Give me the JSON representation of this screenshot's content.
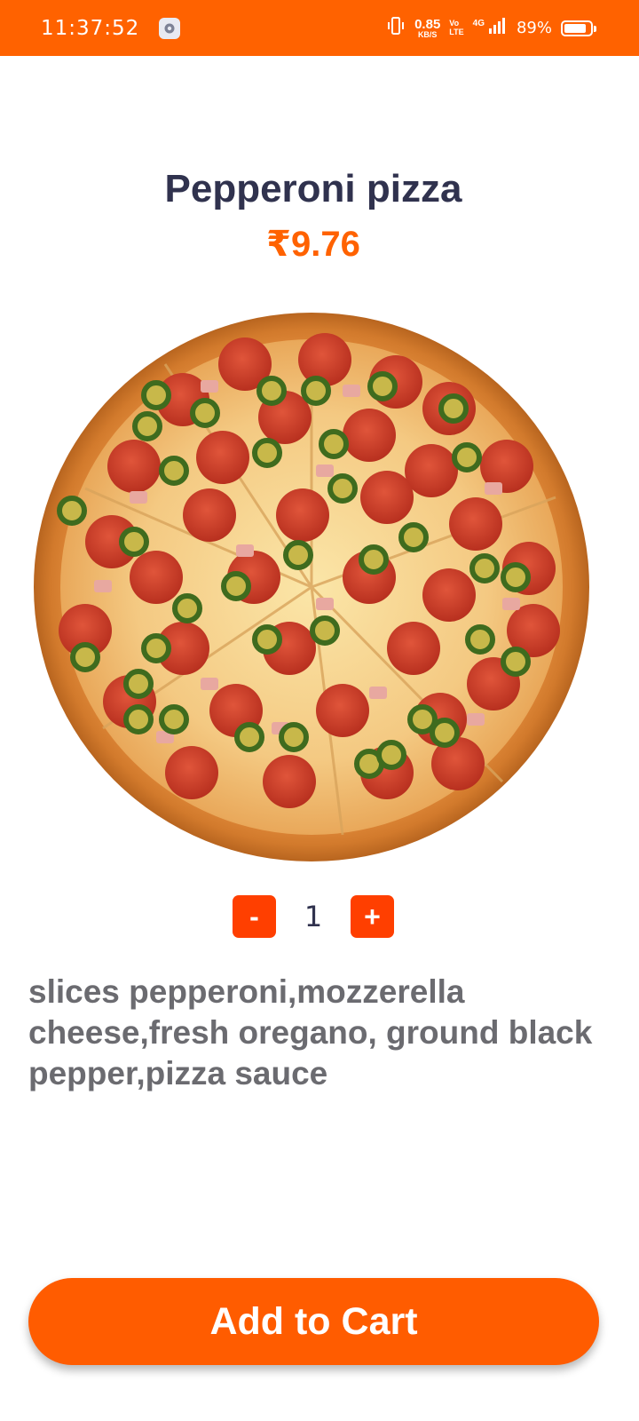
{
  "status_bar": {
    "time": "11:37:52",
    "net_speed_value": "0.85",
    "net_speed_unit": "KB/S",
    "volte_top": "Vo",
    "volte_bottom": "LTE",
    "network_type": "4G",
    "battery_percent": "89%",
    "battery_level": 0.89,
    "background_color": "#ff6200",
    "icons": [
      "settings-icon",
      "vibrate-icon",
      "signal-icon",
      "battery-icon"
    ]
  },
  "product": {
    "title": "Pepperoni pizza",
    "price": "₹9.76",
    "image_icon": "pizza-image",
    "quantity": {
      "minus_label": "-",
      "value": "1",
      "plus_label": "+"
    },
    "description": "slices pepperoni,mozzerella cheese,fresh oregano, ground black pepper,pizza sauce"
  },
  "actions": {
    "add_to_cart_label": "Add to Cart"
  },
  "colors": {
    "accent": "#ff6200",
    "qty_button": "#ff3f00",
    "title": "#30324e",
    "description": "#6b6b70"
  }
}
